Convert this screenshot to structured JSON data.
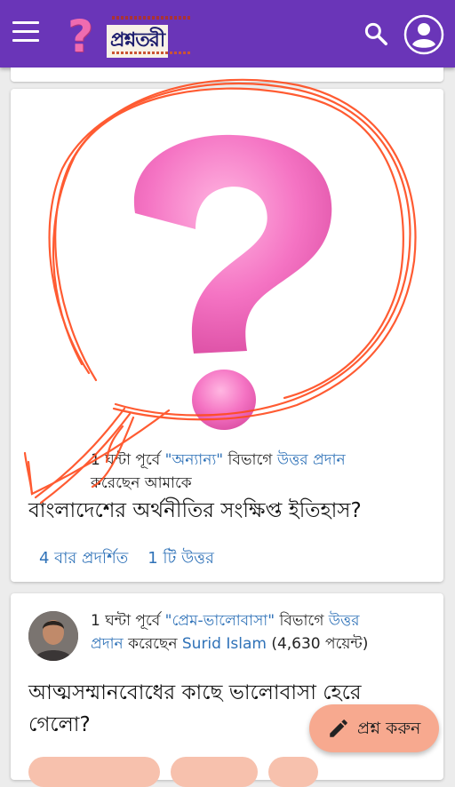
{
  "app": {
    "logo_text": "প্রশ্নতরী",
    "logo_mark": "?"
  },
  "post1": {
    "meta_prefix": "1 ঘন্টা পূর্বে ",
    "category": "\"অন্যান্য\"",
    "meta_mid": " বিভাগে ",
    "action": "উত্তর প্রদান",
    "meta_suffix": "করেছেন আমাকে",
    "title": "বাংলাদেশের অর্থনীতির সংক্ষিপ্ত ইতিহাস?",
    "views": "4 বার প্রদর্শিত",
    "answers": "1 টি উত্তর"
  },
  "post2": {
    "meta_prefix": "1 ঘন্টা পূর্বে ",
    "category": "\"প্রেম-ভালোবাসা\"",
    "meta_mid": " বিভাগে ",
    "action_line1": "উত্তর",
    "action_line2": "প্রদান",
    "meta_suffix": " করেছেন ",
    "user": "Surid Islam",
    "points": " (4,630 পয়েন্ট)",
    "title_line1": "আত্মসম্মানবোধের কাছে ভালোবাসা হেরে",
    "title_line2": "গেলো?"
  },
  "fab": {
    "label": "প্রশ্ন করুন",
    "icon": "pencil-icon"
  },
  "colors": {
    "appbar": "#6a35b8",
    "link": "#2f72b8",
    "fab": "#f7a98f",
    "question_mark": "#f06bb0",
    "scribble": "#ff4a1c"
  }
}
